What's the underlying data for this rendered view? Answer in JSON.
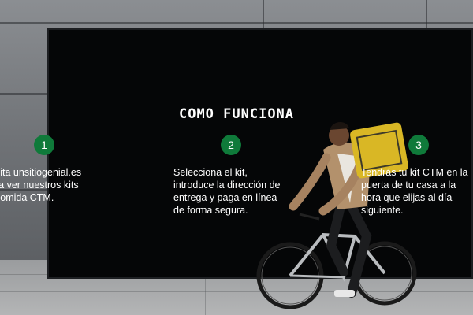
{
  "title": "COMO FUNCIONA",
  "steps": [
    {
      "number": "1",
      "text": "sita unsitiogenial.es\nra ver nuestros kits\ncomida CTM."
    },
    {
      "number": "2",
      "text": "Selecciona el kit,\nintroduce la dirección de\nentrega y paga en línea\nde forma segura."
    },
    {
      "number": "3",
      "text": "Tendrás tu kit CTM en la\npuerta de tu casa a la\nhora que elijas al día\nsiguiente."
    }
  ],
  "colors": {
    "accent": "#0f7a3a",
    "background": "#050607",
    "text": "#ffffff"
  }
}
